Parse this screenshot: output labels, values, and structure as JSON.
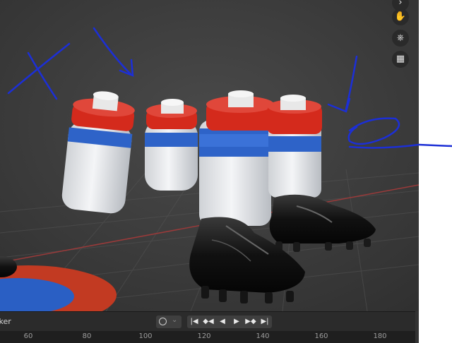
{
  "viewport": {
    "nav_icons": [
      "hand-pan-icon",
      "camera-view-icon",
      "ortho-grid-icon"
    ]
  },
  "timeline": {
    "marker_label": "rker",
    "transport_icons": [
      "jump-start-icon",
      "prev-keyframe-icon",
      "play-reverse-icon",
      "play-icon",
      "next-keyframe-icon",
      "jump-end-icon"
    ],
    "ruler_ticks": [
      "60",
      "80",
      "100",
      "120",
      "140",
      "160",
      "180"
    ]
  },
  "colors": {
    "viewport_bg": "#3d3d3d",
    "sock_red": "#d42a1c",
    "sock_blue": "#2e63c8",
    "annotation_ink": "#1c2fd6"
  }
}
